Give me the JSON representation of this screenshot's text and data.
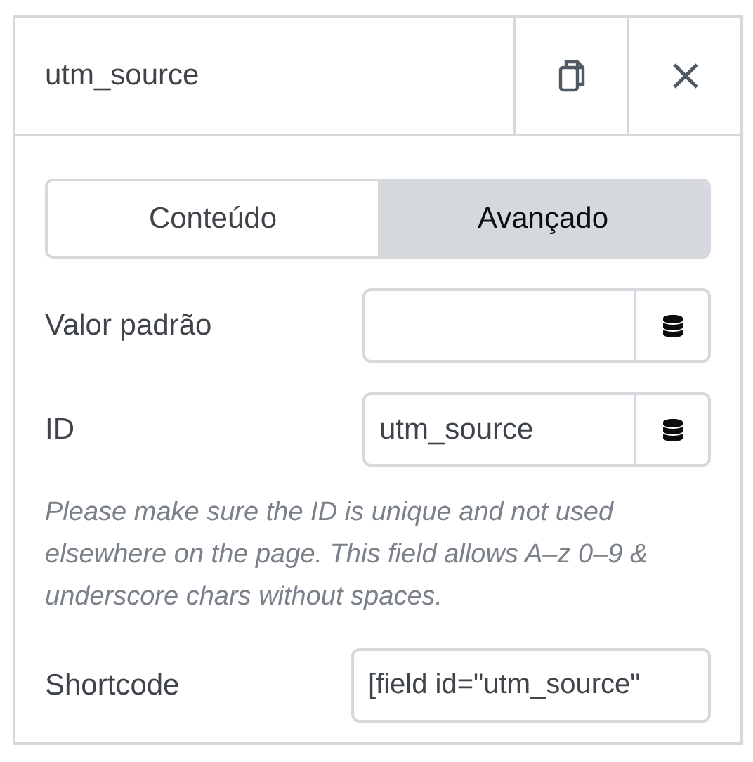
{
  "header": {
    "title": "utm_source"
  },
  "tabs": [
    {
      "label": "Conteúdo",
      "selected": false
    },
    {
      "label": "Avançado",
      "selected": true
    }
  ],
  "fields": [
    {
      "label": "Valor padrão",
      "kind": "dynamic"
    },
    {
      "label": "ID",
      "value": "utm_source",
      "kind": "dynamic"
    }
  ],
  "help_text": "Please make sure the ID is unique and not used elsewhere on the page. This field allows A–z  0–9 & underscore chars without spaces.",
  "shortcode": {
    "label": "Shortcode",
    "value": "[field id=\"utm_source\""
  }
}
